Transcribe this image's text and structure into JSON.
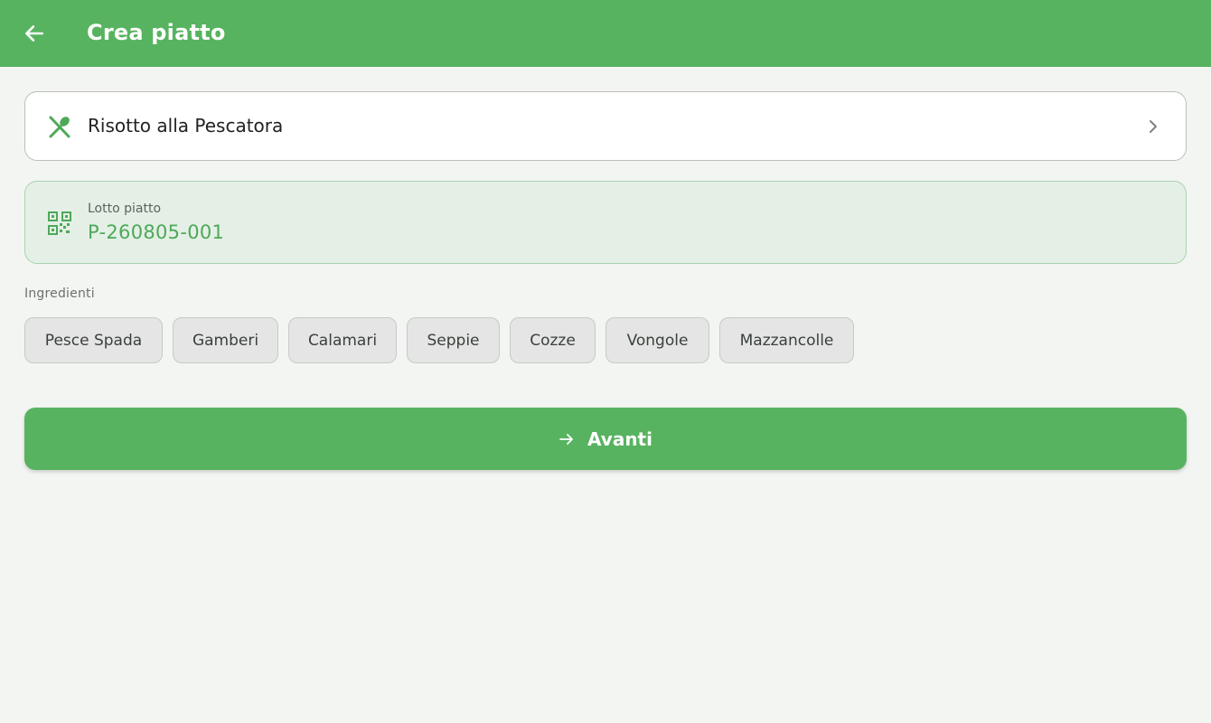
{
  "appbar": {
    "title": "Crea piatto",
    "back_icon": "arrow-left-icon",
    "background": "#57b35f"
  },
  "dish": {
    "name": "Risotto alla Pescatora",
    "icon": "utensils-icon",
    "trailing_icon": "chevron-right-icon"
  },
  "lot": {
    "label": "Lotto piatto",
    "value": "P-260805-001",
    "icon": "qr-code-icon",
    "value_color": "#4fa85a"
  },
  "ingredients": {
    "label": "Ingredienti",
    "items": [
      "Pesce Spada",
      "Gamberi",
      "Calamari",
      "Seppie",
      "Cozze",
      "Vongole",
      "Mazzancolle"
    ]
  },
  "next_button": {
    "label": "Avanti",
    "icon": "arrow-right-icon"
  }
}
